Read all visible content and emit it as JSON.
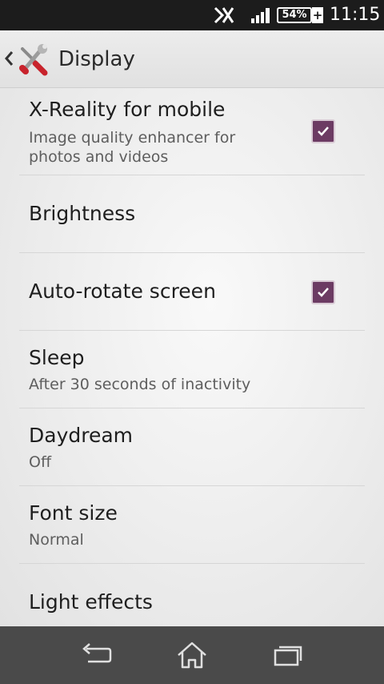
{
  "status_bar": {
    "battery": "54%",
    "battery_plus": "+",
    "time": "11:15"
  },
  "action_bar": {
    "title": "Display"
  },
  "settings": [
    {
      "title": "X-Reality for mobile",
      "summary_line1": "Image quality enhancer for",
      "summary_line2": "photos and videos",
      "checked": true
    },
    {
      "title": "Brightness"
    },
    {
      "title": "Auto-rotate screen",
      "checked": true
    },
    {
      "title": "Sleep",
      "summary": "After 30 seconds of inactivity"
    },
    {
      "title": "Daydream",
      "summary": "Off"
    },
    {
      "title": "Font size",
      "summary": "Normal"
    },
    {
      "title": "Light effects"
    }
  ],
  "colors": {
    "checkbox_fill": "#6c3b63",
    "status_bar": "#1c1c1c",
    "nav_bar": "#4a4a4a"
  },
  "icons": {
    "status": [
      "vibrate-icon",
      "signal-icon",
      "battery-icon"
    ],
    "action_bar": [
      "back-chevron-icon",
      "tools-icon"
    ],
    "nav": [
      "back-icon",
      "home-icon",
      "recents-icon"
    ]
  }
}
